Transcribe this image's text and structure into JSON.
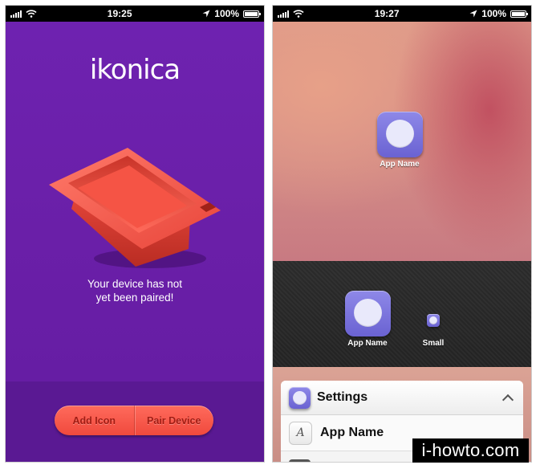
{
  "left": {
    "statusbar": {
      "time": "19:25",
      "battery": "100%",
      "battery_level": 1.0
    },
    "logo": "ikonica",
    "message": [
      "Your device has not",
      "yet been paired!"
    ],
    "actions": {
      "add_icon": "Add Icon",
      "pair_device": "Pair Device"
    },
    "accent_color": "#6a22ab",
    "button_color": "#f0493d"
  },
  "right": {
    "statusbar": {
      "time": "19:27",
      "battery": "100%",
      "battery_level": 1.0
    },
    "home_icon": {
      "label": "App Name",
      "icon": "speech-bubble-icon"
    },
    "dock_icons": [
      {
        "label": "App Name",
        "icon": "speech-bubble-icon"
      },
      {
        "label": "Small",
        "icon": "speech-bubble-icon"
      }
    ],
    "settings": {
      "title": "Settings",
      "rows": [
        {
          "label": "App Name",
          "icon": "font-icon"
        }
      ]
    },
    "icon_color": "#7a72dc"
  },
  "watermark": "i-howto.com"
}
